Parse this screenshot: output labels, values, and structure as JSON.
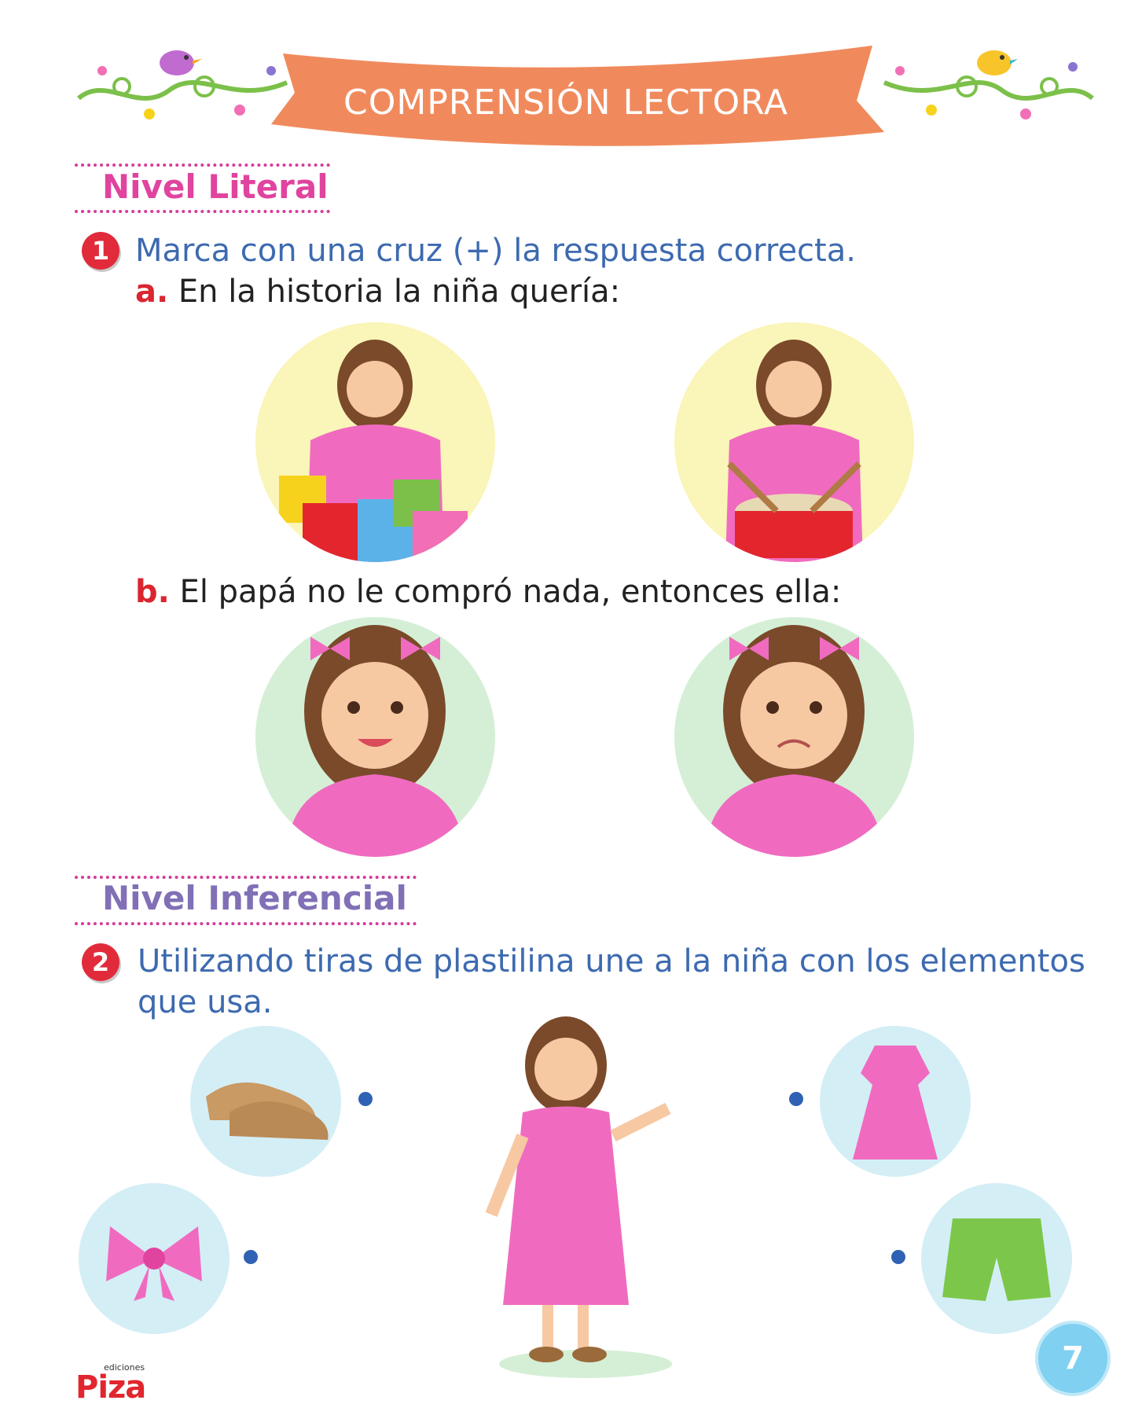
{
  "header": {
    "title": "COMPRENSIÓN LECTORA"
  },
  "sections": [
    {
      "title": "Nivel Literal"
    },
    {
      "title": "Nivel Inferencial"
    }
  ],
  "q1": {
    "number": "1",
    "text": "Marca con una cruz (+) la respuesta correcta.",
    "a_letter": "a.",
    "a_text": "En la historia la niña quería:",
    "b_letter": "b.",
    "b_text": "El papá no le compró nada, entonces ella:"
  },
  "q2": {
    "number": "2",
    "text_line1": "Utilizando tiras de plastilina une a la niña con los elementos",
    "text_line2": "que usa."
  },
  "footer": {
    "page_number": "7",
    "publisher_small": "ediciones",
    "publisher": "Piza"
  },
  "colors": {
    "banner": "#f08a5d",
    "literal": "#e0449e",
    "inferencial": "#8170b6",
    "question_text": "#3d6ab0",
    "number_badge": "#e12b3b"
  }
}
